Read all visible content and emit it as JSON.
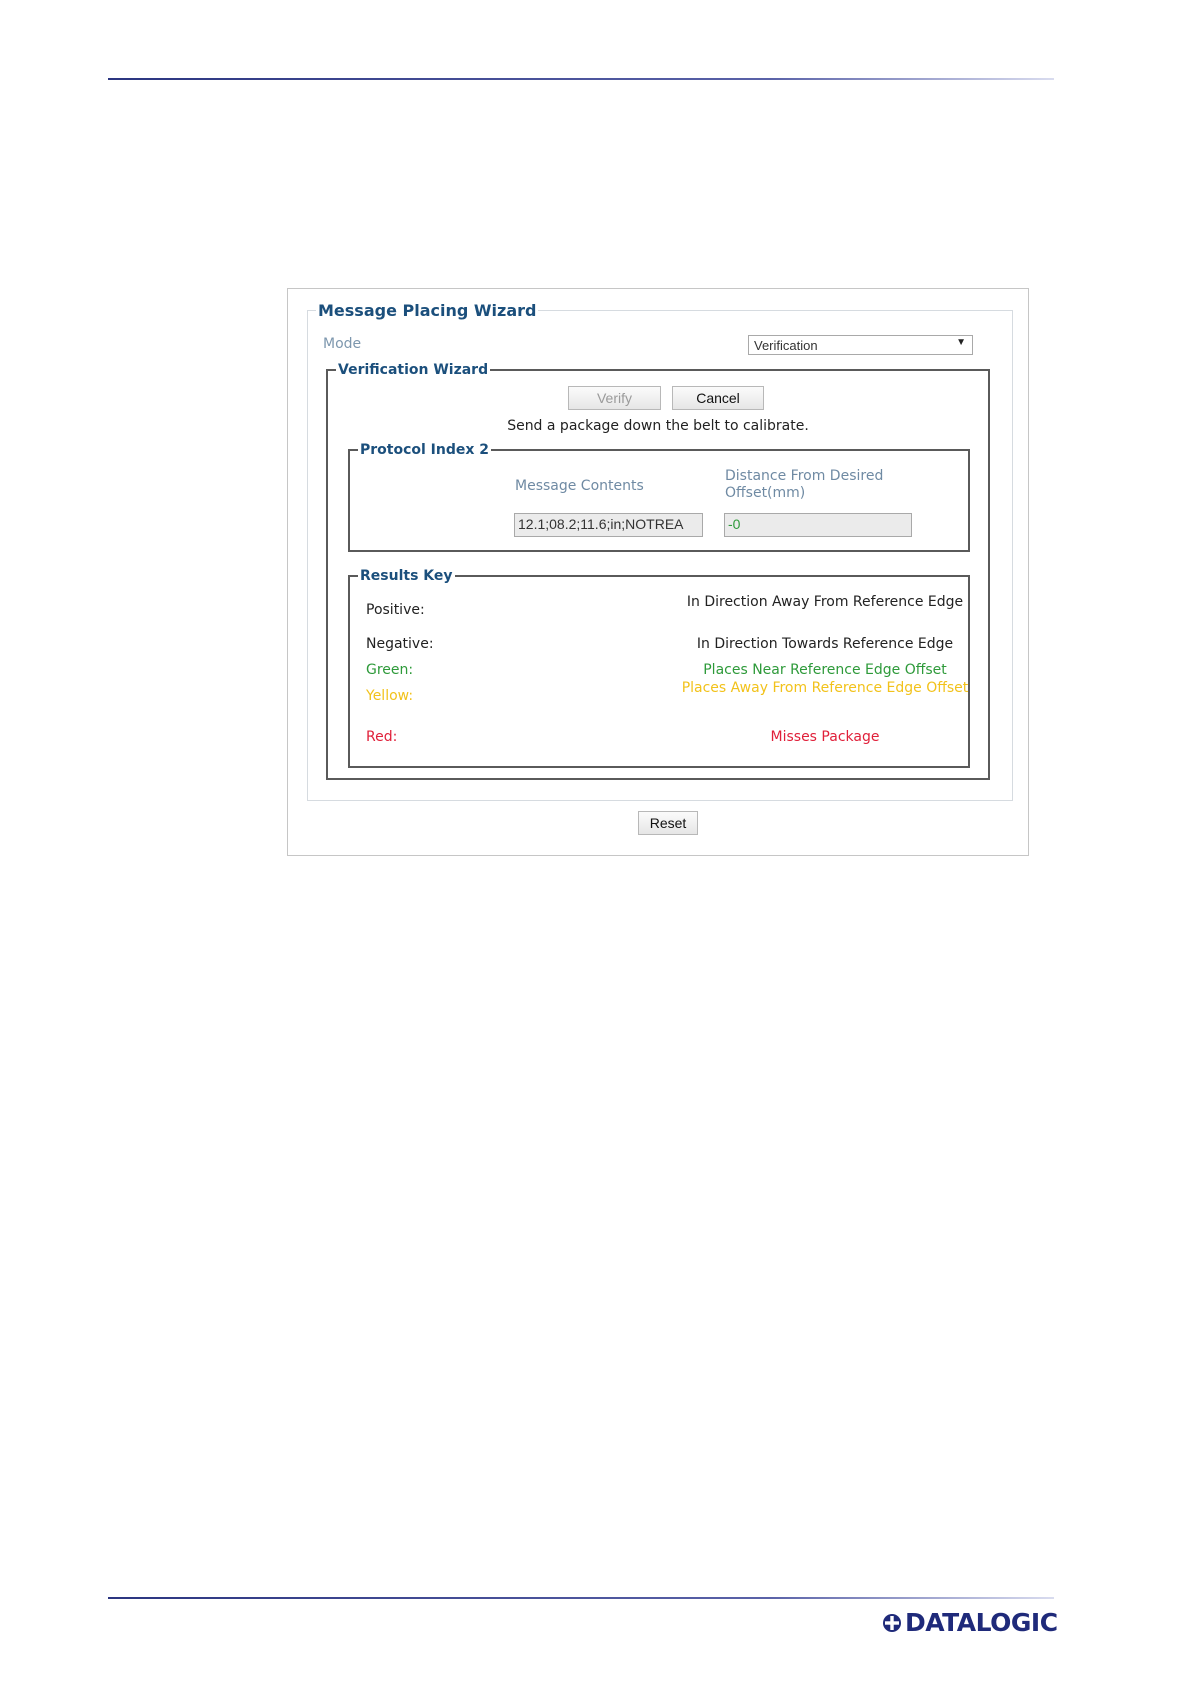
{
  "brand": {
    "logo_text": "DATALOGIC"
  },
  "wizard": {
    "title": "Message Placing Wizard",
    "mode_label": "Mode",
    "mode_value": "Verification",
    "verification": {
      "title": "Verification Wizard",
      "verify_label": "Verify",
      "cancel_label": "Cancel",
      "instruction": "Send a package down the belt to calibrate.",
      "protocol": {
        "title": "Protocol Index 2",
        "message_contents_label": "Message Contents",
        "distance_label": "Distance From Desired Offset(mm)",
        "message_contents_value": "12.1;08.2;11.6;in;NOTREA",
        "distance_value": "-0"
      },
      "results_key": {
        "title": "Results Key",
        "rows": [
          {
            "label": "Positive:",
            "description": "In Direction Away From Reference Edge",
            "color": "#222222"
          },
          {
            "label": "Negative:",
            "description": "In Direction Towards Reference Edge",
            "color": "#222222"
          },
          {
            "label": "Green:",
            "description": "Places Near Reference Edge Offset",
            "color": "#2e9a3a"
          },
          {
            "label": "Yellow:",
            "description": "Places Away From Reference Edge Offset",
            "color": "#f2c21b"
          },
          {
            "label": "Red:",
            "description": "Misses Package",
            "color": "#e0203a"
          }
        ]
      }
    },
    "reset_label": "Reset"
  }
}
